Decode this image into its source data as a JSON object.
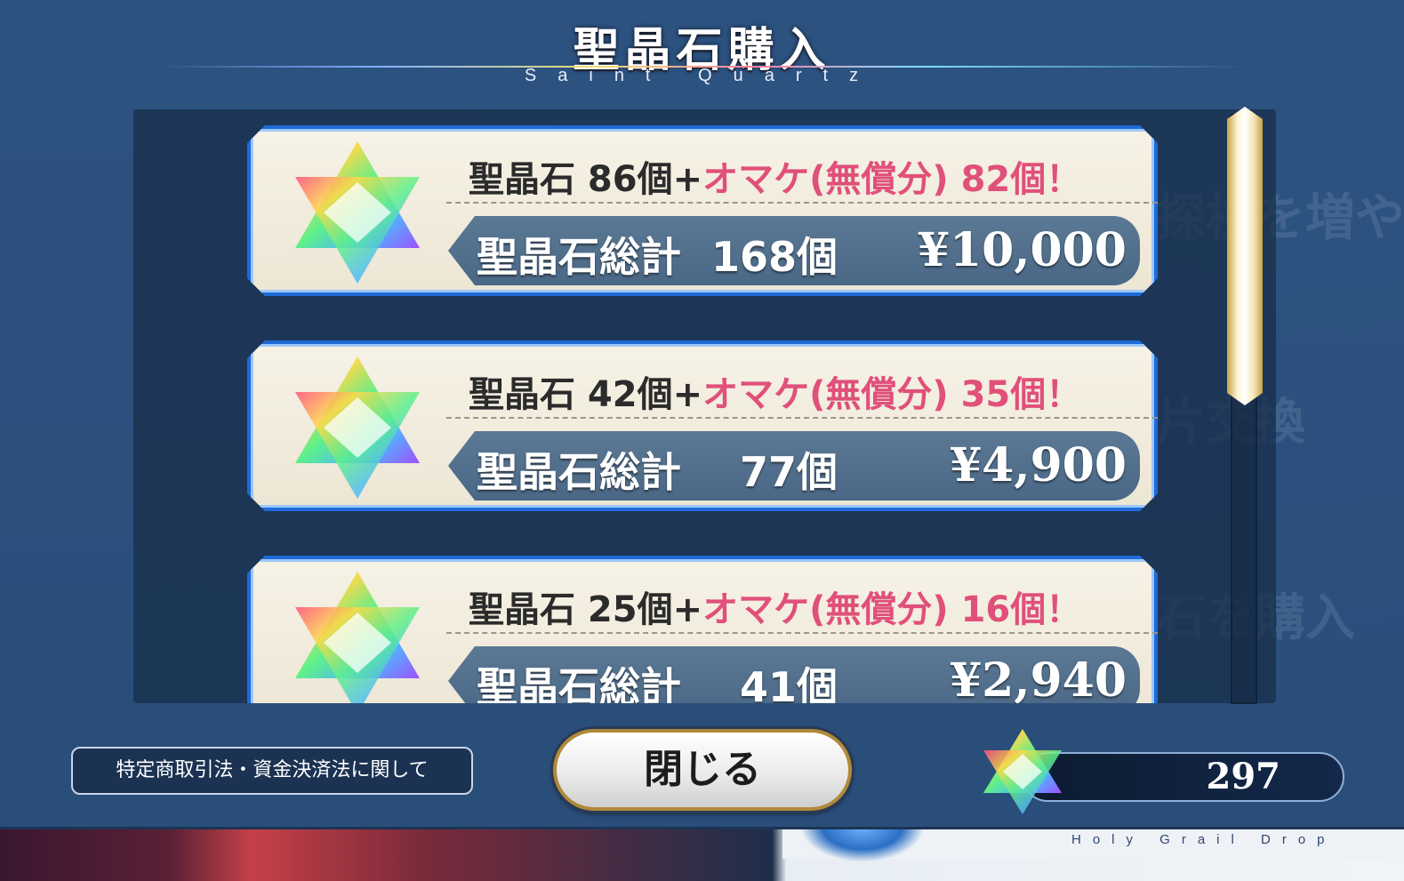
{
  "title": "聖晶石購入",
  "subtitle": "Saint Quartz",
  "items": [
    {
      "base": "聖晶石 86個",
      "plus": "+",
      "bonus": "オマケ(無償分) 82個！",
      "total_label": "聖晶石総計",
      "total_count": "168個",
      "price": "¥10,000"
    },
    {
      "base": "聖晶石 42個",
      "plus": "+",
      "bonus": "オマケ(無償分) 35個！",
      "total_label": "聖晶石総計",
      "total_count": "77個",
      "price": "¥4,900"
    },
    {
      "base": "聖晶石 25個",
      "plus": "+",
      "bonus": "オマケ(無償分) 16個！",
      "total_label": "聖晶石総計",
      "total_count": "41個",
      "price": "¥2,940"
    }
  ],
  "footer": {
    "legal_link": "特定商取引法・資金決済法に関して",
    "close_label": "閉じる",
    "quartz_balance": "297"
  },
  "background": {
    "holy_grail_text": "Holy Grail Drop",
    "ghost_texts": [
      "探検を増や",
      "片交換",
      "石を購入"
    ]
  },
  "colors": {
    "item_border": "#1e6ad6",
    "bonus_text": "#e0507a",
    "panel": "#2b4f78"
  },
  "icons": {
    "quartz": "saint-quartz-icon"
  }
}
